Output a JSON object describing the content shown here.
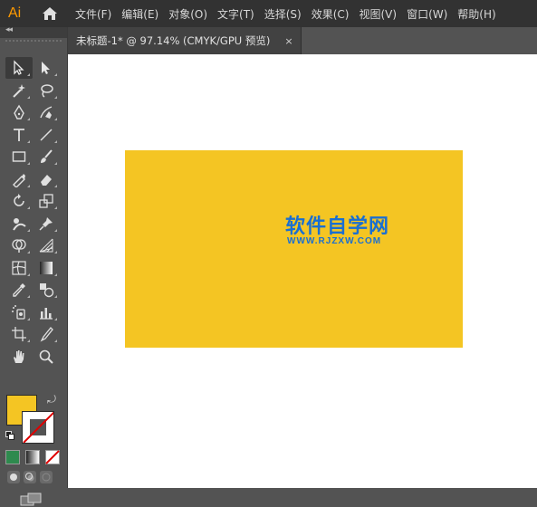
{
  "app": {
    "logo": "Ai",
    "home_icon": "home-icon"
  },
  "menu": [
    "文件(F)",
    "编辑(E)",
    "对象(O)",
    "文字(T)",
    "选择(S)",
    "效果(C)",
    "视图(V)",
    "窗口(W)",
    "帮助(H)"
  ],
  "toolbar": {
    "collapse": "◂◂",
    "tools": [
      [
        "selection-tool",
        "direct-selection-tool"
      ],
      [
        "magic-wand-tool",
        "lasso-tool"
      ],
      [
        "pen-tool",
        "curvature-tool"
      ],
      [
        "type-tool",
        "line-segment-tool"
      ],
      [
        "rectangle-tool",
        "paintbrush-tool"
      ],
      [
        "shaper-tool",
        "eraser-tool"
      ],
      [
        "rotate-tool",
        "scale-tool"
      ],
      [
        "puppet-warp-tool",
        "pin-tool"
      ],
      [
        "shape-builder-tool",
        "perspective-grid-tool"
      ],
      [
        "mesh-tool",
        "gradient-tool"
      ],
      [
        "eyedropper-tool",
        "blend-tool"
      ],
      [
        "symbol-sprayer-tool",
        "column-graph-tool"
      ],
      [
        "artboard-tool",
        "slice-tool"
      ],
      [
        "hand-tool",
        "zoom-tool"
      ]
    ],
    "fill_color": "#f4c523",
    "stroke": "none",
    "swap_icon": "⤾"
  },
  "document": {
    "tab_label": "未标题-1* @ 97.14% (CMYK/GPU 预览)",
    "close": "×",
    "rect_color": "#f4c523",
    "watermark_title": "软件自学网",
    "watermark_url": "WWW.RJZXW.COM",
    "watermark_color": "#1a6fd1"
  }
}
